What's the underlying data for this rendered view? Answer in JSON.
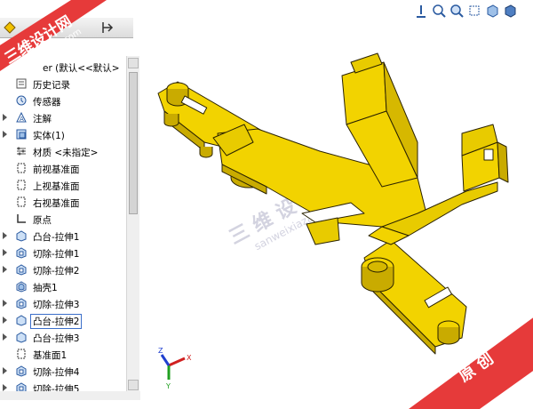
{
  "feature_tree": {
    "top_label": "er (默认<<默认>",
    "items": [
      {
        "label": "历史记录",
        "icon": "history-icon",
        "expandable": false
      },
      {
        "label": "传感器",
        "icon": "sensor-icon",
        "expandable": false
      },
      {
        "label": "注解",
        "icon": "annotation-icon",
        "expandable": true
      },
      {
        "label": "实体(1)",
        "icon": "solid-bodies-icon",
        "expandable": true
      },
      {
        "label": "材质 <未指定>",
        "icon": "material-icon",
        "expandable": false
      },
      {
        "label": "前视基准面",
        "icon": "plane-icon",
        "expandable": false
      },
      {
        "label": "上视基准面",
        "icon": "plane-icon",
        "expandable": false
      },
      {
        "label": "右视基准面",
        "icon": "plane-icon",
        "expandable": false
      },
      {
        "label": "原点",
        "icon": "origin-icon",
        "expandable": false
      },
      {
        "label": "凸台-拉伸1",
        "icon": "boss-extrude-icon",
        "expandable": true
      },
      {
        "label": "切除-拉伸1",
        "icon": "cut-extrude-icon",
        "expandable": true
      },
      {
        "label": "切除-拉伸2",
        "icon": "cut-extrude-icon",
        "expandable": true
      },
      {
        "label": "抽壳1",
        "icon": "shell-icon",
        "expandable": false
      },
      {
        "label": "切除-拉伸3",
        "icon": "cut-extrude-icon",
        "expandable": true
      },
      {
        "label": "凸台-拉伸2",
        "icon": "boss-extrude-icon",
        "expandable": true,
        "selected": true
      },
      {
        "label": "凸台-拉伸3",
        "icon": "boss-extrude-icon",
        "expandable": true
      },
      {
        "label": "基准面1",
        "icon": "plane-icon",
        "expandable": false
      },
      {
        "label": "切除-拉伸4",
        "icon": "cut-extrude-icon",
        "expandable": true
      },
      {
        "label": "切除-拉伸5",
        "icon": "cut-extrude-icon",
        "expandable": true
      }
    ]
  },
  "watermark": {
    "brand_cn": "三维设计网",
    "brand_url": "sanweixiazai.com",
    "center_cn": "三 维 设 计 网",
    "center_url": "sanweixiazai.com",
    "original_cn": "原 创"
  },
  "triad": {
    "x": "X",
    "y": "Y",
    "z": "Z"
  },
  "colors": {
    "model": "#f2d300",
    "model_edge": "#1a1a00",
    "watermark_red": "#e63a3a",
    "selection": "#3b6ec9"
  }
}
